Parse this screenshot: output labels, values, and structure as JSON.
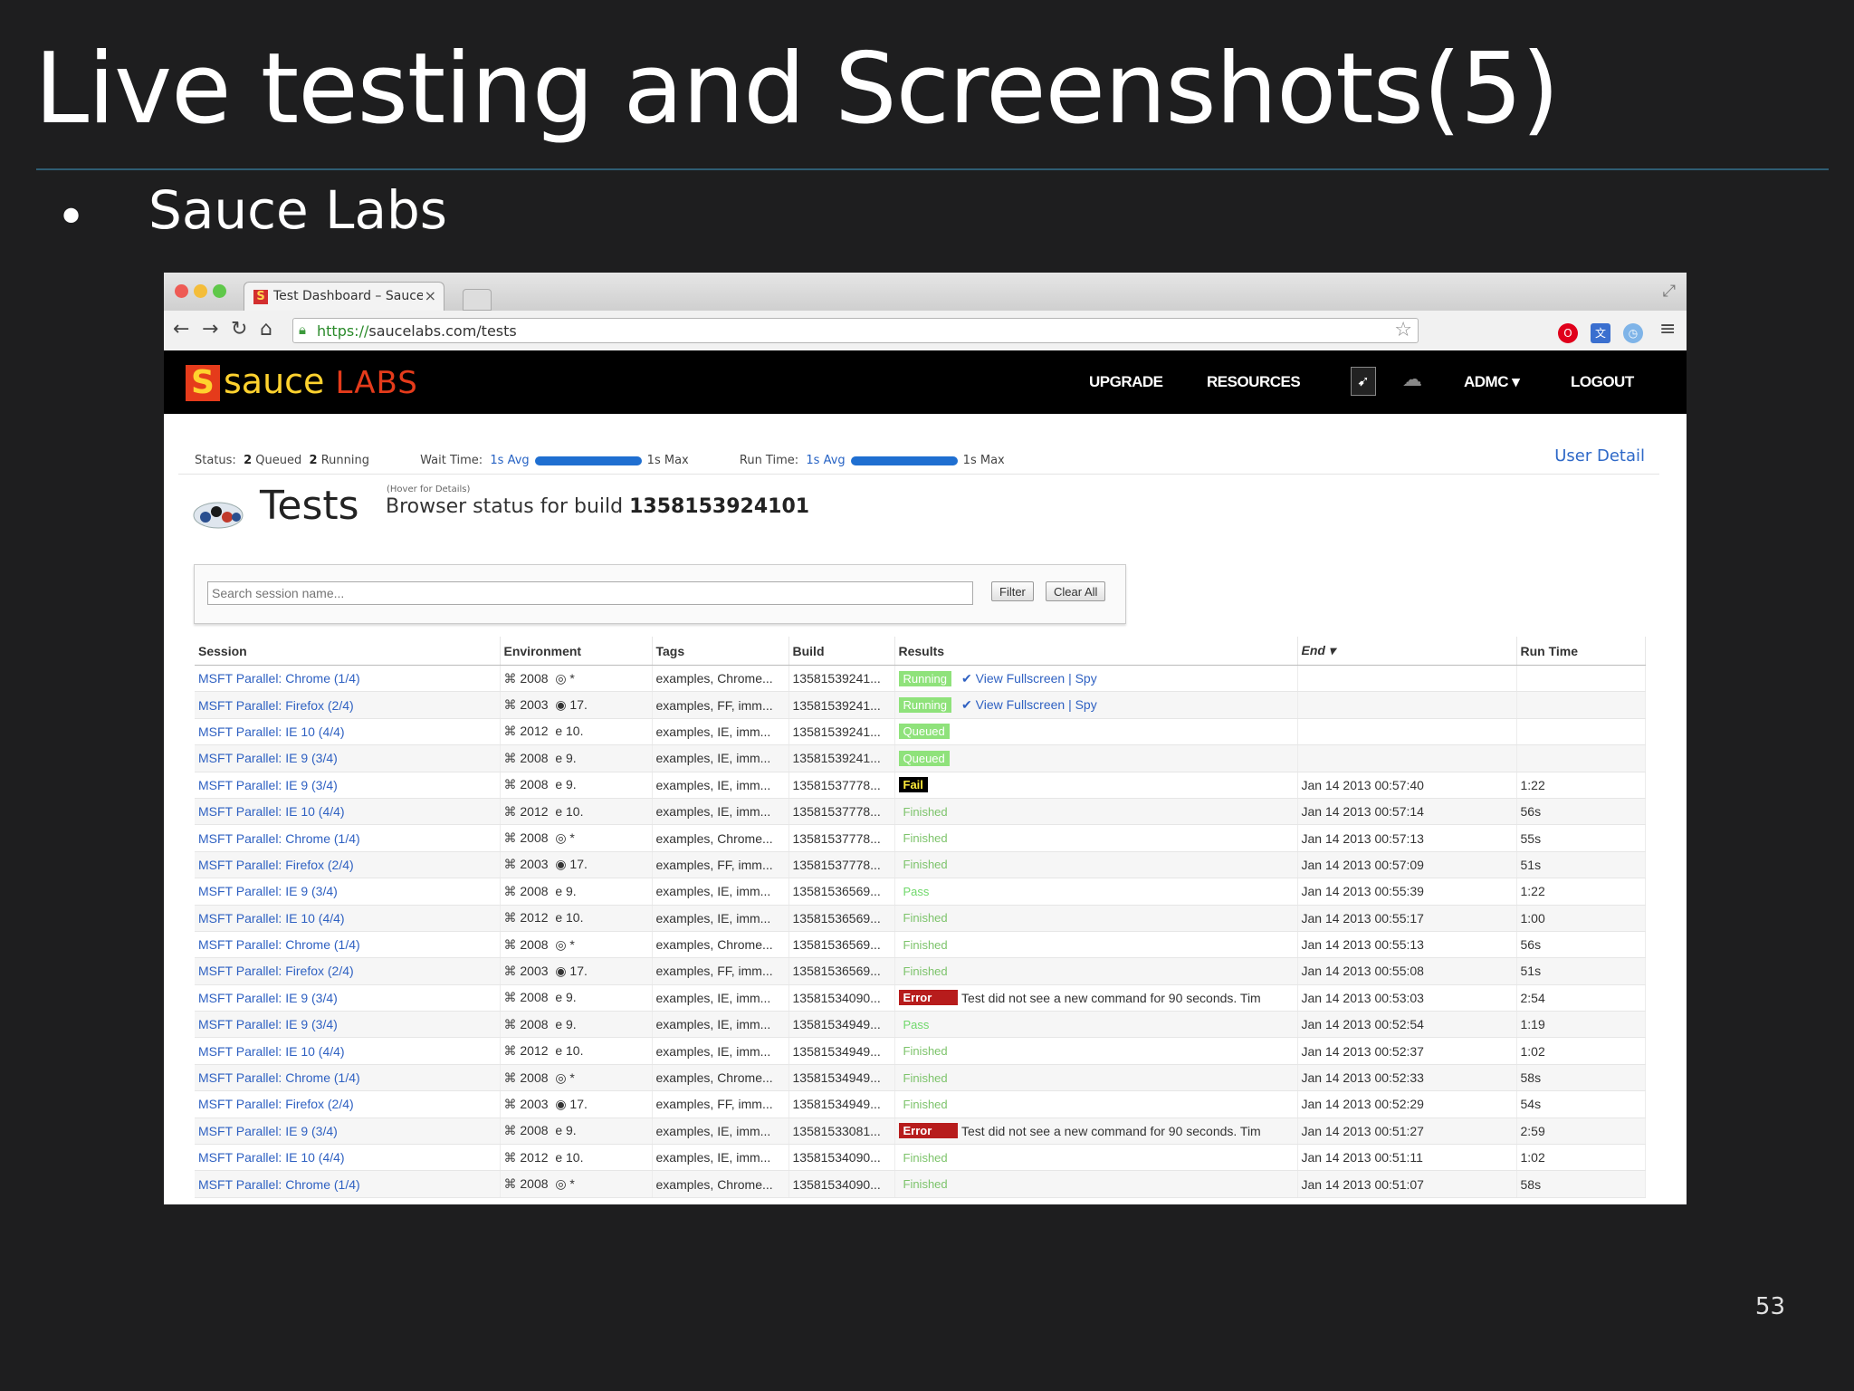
{
  "slide": {
    "title": "Live testing and Screenshots(5)",
    "bullet_symbol": "•",
    "bullet_text": "Sauce Labs",
    "page_number": "53"
  },
  "browser": {
    "tab_title": "Test Dashboard – Sauce Lab",
    "tab_close": "×",
    "url_protocol": "https://",
    "url_rest": "saucelabs.com/tests"
  },
  "site": {
    "logo_mark": "S",
    "logo_word": "sauce",
    "logo_labs": "LABS",
    "nav": {
      "upgrade": "UPGRADE",
      "resources": "RESOURCES",
      "account": "ADMC",
      "logout": "LOGOUT"
    }
  },
  "stats": {
    "status_label": "Status:",
    "queued_count": "2",
    "queued_label": "Queued",
    "running_count": "2",
    "running_label": "Running",
    "wait_label": "Wait Time:",
    "wait_avg": "1s Avg",
    "wait_max": "1s Max",
    "run_label": "Run Time:",
    "run_avg": "1s Avg",
    "run_max": "1s Max",
    "user_detail": "User Detail"
  },
  "tests": {
    "heading": "Tests",
    "hover_hint": "(Hover for Details)",
    "build_prefix": "Browser status for build",
    "build_number": "1358153924101"
  },
  "search": {
    "placeholder": "Search session name...",
    "filter_label": "Filter",
    "clear_label": "Clear All"
  },
  "table": {
    "headers": [
      "Session",
      "Environment",
      "Tags",
      "Build",
      "Results",
      "",
      "End ▾",
      "Run Time"
    ],
    "rows": [
      {
        "session": "MSFT Parallel: Chrome (1/4)",
        "os": "2008",
        "browser": "◎ *",
        "tags": "examples, Chrome...",
        "build": "13581539241...",
        "result": "Running",
        "detail": "✔ View Fullscreen | Spy",
        "end": "",
        "runtime": ""
      },
      {
        "session": "MSFT Parallel: Firefox (2/4)",
        "os": "2003",
        "browser": "◉ 17.",
        "tags": "examples, FF, imm...",
        "build": "13581539241...",
        "result": "Running",
        "detail": "✔ View Fullscreen | Spy",
        "end": "",
        "runtime": ""
      },
      {
        "session": "MSFT Parallel: IE 10 (4/4)",
        "os": "2012",
        "browser": "e 10.",
        "tags": "examples, IE, imm...",
        "build": "13581539241...",
        "result": "Queued",
        "detail": "",
        "end": "",
        "runtime": ""
      },
      {
        "session": "MSFT Parallel: IE 9 (3/4)",
        "os": "2008",
        "browser": "e 9.",
        "tags": "examples, IE, imm...",
        "build": "13581539241...",
        "result": "Queued",
        "detail": "",
        "end": "",
        "runtime": ""
      },
      {
        "session": "MSFT Parallel: IE 9 (3/4)",
        "os": "2008",
        "browser": "e 9.",
        "tags": "examples, IE, imm...",
        "build": "13581537778...",
        "result": "Fail",
        "detail": "",
        "end": "Jan 14 2013 00:57:40",
        "runtime": "1:22"
      },
      {
        "session": "MSFT Parallel: IE 10 (4/4)",
        "os": "2012",
        "browser": "e 10.",
        "tags": "examples, IE, imm...",
        "build": "13581537778...",
        "result": "Finished",
        "detail": "",
        "end": "Jan 14 2013 00:57:14",
        "runtime": "56s"
      },
      {
        "session": "MSFT Parallel: Chrome (1/4)",
        "os": "2008",
        "browser": "◎ *",
        "tags": "examples, Chrome...",
        "build": "13581537778...",
        "result": "Finished",
        "detail": "",
        "end": "Jan 14 2013 00:57:13",
        "runtime": "55s"
      },
      {
        "session": "MSFT Parallel: Firefox (2/4)",
        "os": "2003",
        "browser": "◉ 17.",
        "tags": "examples, FF, imm...",
        "build": "13581537778...",
        "result": "Finished",
        "detail": "",
        "end": "Jan 14 2013 00:57:09",
        "runtime": "51s"
      },
      {
        "session": "MSFT Parallel: IE 9 (3/4)",
        "os": "2008",
        "browser": "e 9.",
        "tags": "examples, IE, imm...",
        "build": "13581536569...",
        "result": "Pass",
        "detail": "",
        "end": "Jan 14 2013 00:55:39",
        "runtime": "1:22"
      },
      {
        "session": "MSFT Parallel: IE 10 (4/4)",
        "os": "2012",
        "browser": "e 10.",
        "tags": "examples, IE, imm...",
        "build": "13581536569...",
        "result": "Finished",
        "detail": "",
        "end": "Jan 14 2013 00:55:17",
        "runtime": "1:00"
      },
      {
        "session": "MSFT Parallel: Chrome (1/4)",
        "os": "2008",
        "browser": "◎ *",
        "tags": "examples, Chrome...",
        "build": "13581536569...",
        "result": "Finished",
        "detail": "",
        "end": "Jan 14 2013 00:55:13",
        "runtime": "56s"
      },
      {
        "session": "MSFT Parallel: Firefox (2/4)",
        "os": "2003",
        "browser": "◉ 17.",
        "tags": "examples, FF, imm...",
        "build": "13581536569...",
        "result": "Finished",
        "detail": "",
        "end": "Jan 14 2013 00:55:08",
        "runtime": "51s"
      },
      {
        "session": "MSFT Parallel: IE 9 (3/4)",
        "os": "2008",
        "browser": "e 9.",
        "tags": "examples, IE, imm...",
        "build": "13581534090...",
        "result": "Error",
        "detail": "Test did not see a new command for 90 seconds. Tim",
        "end": "Jan 14 2013 00:53:03",
        "runtime": "2:54"
      },
      {
        "session": "MSFT Parallel: IE 9 (3/4)",
        "os": "2008",
        "browser": "e 9.",
        "tags": "examples, IE, imm...",
        "build": "13581534949...",
        "result": "Pass",
        "detail": "",
        "end": "Jan 14 2013 00:52:54",
        "runtime": "1:19"
      },
      {
        "session": "MSFT Parallel: IE 10 (4/4)",
        "os": "2012",
        "browser": "e 10.",
        "tags": "examples, IE, imm...",
        "build": "13581534949...",
        "result": "Finished",
        "detail": "",
        "end": "Jan 14 2013 00:52:37",
        "runtime": "1:02"
      },
      {
        "session": "MSFT Parallel: Chrome (1/4)",
        "os": "2008",
        "browser": "◎ *",
        "tags": "examples, Chrome...",
        "build": "13581534949...",
        "result": "Finished",
        "detail": "",
        "end": "Jan 14 2013 00:52:33",
        "runtime": "58s"
      },
      {
        "session": "MSFT Parallel: Firefox (2/4)",
        "os": "2003",
        "browser": "◉ 17.",
        "tags": "examples, FF, imm...",
        "build": "13581534949...",
        "result": "Finished",
        "detail": "",
        "end": "Jan 14 2013 00:52:29",
        "runtime": "54s"
      },
      {
        "session": "MSFT Parallel: IE 9 (3/4)",
        "os": "2008",
        "browser": "e 9.",
        "tags": "examples, IE, imm...",
        "build": "13581533081...",
        "result": "Error",
        "detail": "Test did not see a new command for 90 seconds. Tim",
        "end": "Jan 14 2013 00:51:27",
        "runtime": "2:59"
      },
      {
        "session": "MSFT Parallel: IE 10 (4/4)",
        "os": "2012",
        "browser": "e 10.",
        "tags": "examples, IE, imm...",
        "build": "13581534090...",
        "result": "Finished",
        "detail": "",
        "end": "Jan 14 2013 00:51:11",
        "runtime": "1:02"
      },
      {
        "session": "MSFT Parallel: Chrome (1/4)",
        "os": "2008",
        "browser": "◎ *",
        "tags": "examples, Chrome...",
        "build": "13581534090...",
        "result": "Finished",
        "detail": "",
        "end": "Jan 14 2013 00:51:07",
        "runtime": "58s"
      }
    ]
  },
  "colors": {
    "slide_bg": "#1e1e1f",
    "brand_yellow": "#ffd22e",
    "brand_red": "#e53b1b",
    "link_blue": "#2f61c2",
    "running_green": "#8fe27b",
    "error_red": "#b71c1c"
  },
  "icons": {
    "os": "windows-icon",
    "back": "back-arrow-icon",
    "forward": "forward-arrow-icon",
    "reload": "reload-icon",
    "home": "home-icon",
    "bookmark": "star-icon",
    "menu": "hamburger-menu-icon"
  }
}
